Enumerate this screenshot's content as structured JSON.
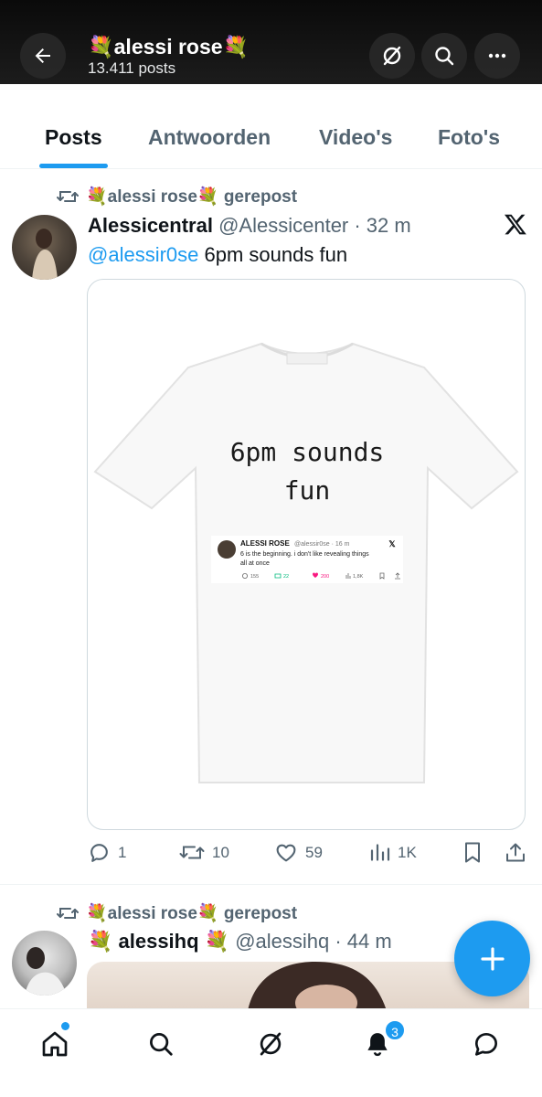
{
  "header": {
    "title": "💐alessi rose💐",
    "post_count": "13.411 posts"
  },
  "tabs": [
    {
      "label": "Posts"
    },
    {
      "label": "Antwoorden"
    },
    {
      "label": "Video's"
    },
    {
      "label": "Foto's"
    }
  ],
  "posts": [
    {
      "repost_label": "💐alessi rose💐 gerepost",
      "display_name": "Alessicentral",
      "handle_time": "@Alessicenter · 32 m",
      "mention": "@alessir0se",
      "text": " 6pm sounds fun",
      "media": {
        "shirt_text_line1": "6pm sounds",
        "shirt_text_line2": "fun",
        "embedded_tweet": {
          "name": "ALESSI ROSE",
          "handle_time": "@alessir0se · 16 m",
          "text_line1": "6 is the beginning. i don't like revealing things",
          "text_line2": "all at once",
          "replies": "155",
          "reposts": "22",
          "likes": "200",
          "views": "1,8K"
        }
      },
      "actions": {
        "replies": "1",
        "reposts": "10",
        "likes": "59",
        "views": "1K"
      }
    },
    {
      "repost_label": "💐alessi rose💐 gerepost",
      "display_name": "💐 alessihq 💐",
      "handle_time": "@alessihq · 44 m"
    }
  ],
  "nav": {
    "notifications_badge": "3"
  },
  "colors": {
    "accent": "#1d9bf0",
    "text": "#0f1419",
    "muted": "#536471",
    "like_pink": "#f91880",
    "repost_green": "#00ba7c"
  },
  "icons": [
    "back-arrow-icon",
    "grok-icon",
    "search-icon",
    "more-icon",
    "repost-icon",
    "x-logo-icon",
    "reply-icon",
    "like-icon",
    "views-icon",
    "bookmark-icon",
    "share-icon",
    "plus-icon",
    "home-icon",
    "notifications-icon",
    "messages-icon"
  ]
}
